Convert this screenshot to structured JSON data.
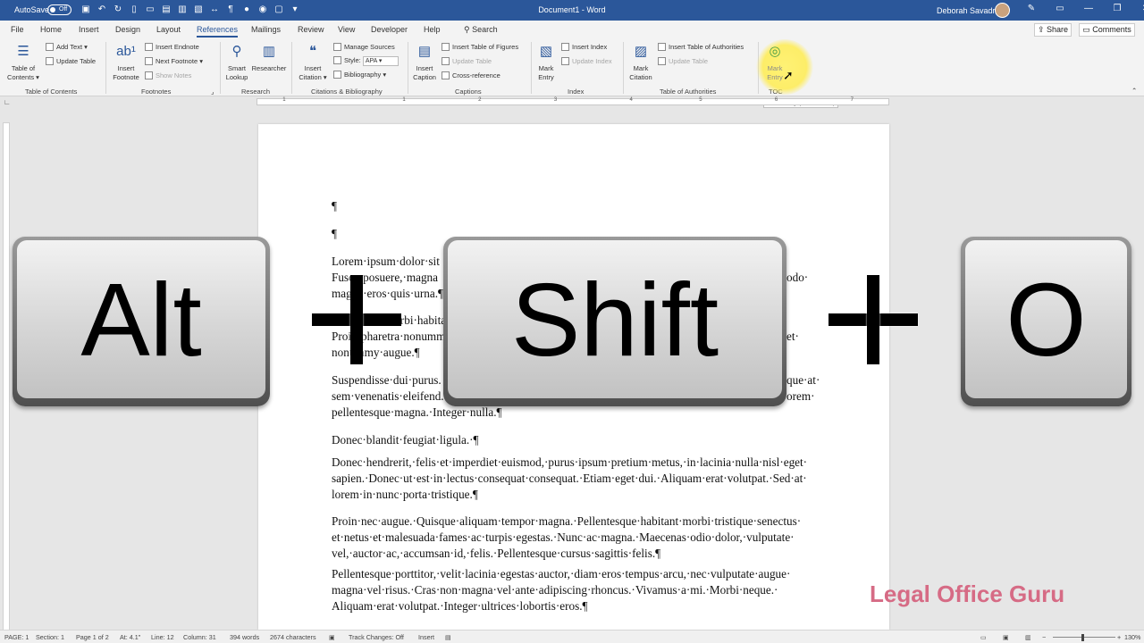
{
  "titlebar": {
    "autosave": "AutoSave",
    "autosave_state": "Off",
    "document": "Document1 - Word",
    "user": "Deborah Savadra"
  },
  "tabs": [
    "File",
    "Home",
    "Insert",
    "Design",
    "Layout",
    "References",
    "Mailings",
    "Review",
    "View",
    "Developer",
    "Help"
  ],
  "search": {
    "label": "Search"
  },
  "share": {
    "label": "Share"
  },
  "comments": {
    "label": "Comments"
  },
  "ribbon": {
    "toc": {
      "button": "Table of Contents",
      "add_text": "Add Text",
      "update_table": "Update Table",
      "group": "Table of Contents"
    },
    "footnotes": {
      "insert_footnote": "Insert Footnote",
      "insert_endnote": "Insert Endnote",
      "next_footnote": "Next Footnote",
      "show_notes": "Show Notes",
      "group": "Footnotes"
    },
    "research": {
      "smart_lookup": "Smart Lookup",
      "researcher": "Researcher",
      "group": "Research"
    },
    "citations": {
      "insert_citation": "Insert Citation",
      "manage_sources": "Manage Sources",
      "style_label": "Style:",
      "style_value": "APA",
      "bibliography": "Bibliography",
      "group": "Citations & Bibliography"
    },
    "captions": {
      "insert_caption": "Insert Caption",
      "insert_tof": "Insert Table of Figures",
      "update_table": "Update Table",
      "cross_reference": "Cross-reference",
      "group": "Captions"
    },
    "index": {
      "mark_entry": "Mark Entry",
      "insert_index": "Insert Index",
      "update_index": "Update Index",
      "group": "Index"
    },
    "toa": {
      "mark_citation": "Mark Citation",
      "insert_toa": "Insert Table of Authorities",
      "update_table": "Update Table",
      "group": "Table of Authorities"
    },
    "tocgroup": {
      "mark_entry": "Mark Entry",
      "group": "TOC"
    }
  },
  "tooltip": "Mark Entry (Alt+Shift+O)",
  "document": {
    "paragraphs": [
      [
        "¶"
      ],
      [
        "¶"
      ],
      [
        "Lorem·ipsum·dolor·sit",
        "Fusce·posuere,·magna",
        "magna·eros·quis·urna.¶"
      ],
      [
        "morbi·habitant·m",
        "Proin·pharetra·nonumm",
        "nonummy·augue.¶"
      ],
      [
        "Suspendisse·dui·purus.",
        "sem·venenatis·eleifend.",
        "pellentesque·magna.·Integer·nulla.¶"
      ],
      [
        "Donec·blandit·feugiat·ligula.·¶"
      ],
      [
        "Donec·hendrerit,·felis·et·imperdiet·euismod,·purus·ipsum·pretium·metus,·in·lacinia·nulla·nisl·eget·",
        "sapien.·Donec·ut·est·in·lectus·consequat·consequat.·Etiam·eget·dui.·Aliquam·erat·volutpat.·Sed·at·",
        "lorem·in·nunc·porta·tristique.¶"
      ],
      [
        "Proin·nec·augue.·Quisque·aliquam·tempor·magna.·Pellentesque·habitant·morbi·tristique·senectus·",
        "et·netus·et·malesuada·fames·ac·turpis·egestas.·Nunc·ac·magna.·Maecenas·odio·dolor,·vulputate·",
        "vel,·auctor·ac,·accumsan·id,·felis.·Pellentesque·cursus·sagittis·felis.¶"
      ],
      [
        "Pellentesque·porttitor,·velit·lacinia·egestas·auctor,·diam·eros·tempus·arcu,·nec·vulputate·augue·",
        "magna·vel·risus.·Cras·non·magna·vel·ante·adipiscing·rhoncus.·Vivamus·a·mi.·Morbi·neque.·",
        "Aliquam·erat·volutpat.·Integer·ultrices·lobortis·eros.¶"
      ]
    ],
    "right_fragments": [
      "odo·",
      "et·",
      "que·at·",
      "orem·"
    ]
  },
  "keys": {
    "alt": "Alt",
    "shift": "Shift",
    "o": "O"
  },
  "watermark": "Legal Office Guru",
  "statusbar": {
    "page": "PAGE: 1",
    "section": "Section: 1",
    "pages": "Page 1 of 2",
    "at": "At: 4.1\"",
    "line": "Line: 12",
    "column": "Column: 31",
    "words": "394 words",
    "characters": "2674 characters",
    "track_changes": "Track Changes: Off",
    "insert": "Insert",
    "zoom": "130%"
  },
  "ruler": {
    "numbers": [
      "1",
      "1",
      "2",
      "3",
      "4",
      "5",
      "6",
      "7"
    ]
  }
}
